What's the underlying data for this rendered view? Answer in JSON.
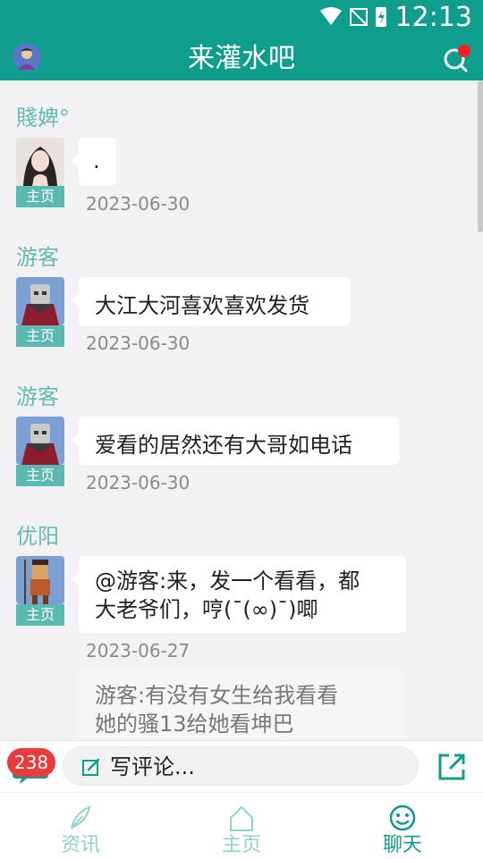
{
  "status": {
    "time": "12:13"
  },
  "appbar": {
    "title": "来灌水吧"
  },
  "messages": [
    {
      "user": "賤婢°",
      "home_label": "主页",
      "text": ".",
      "date": "2023-06-30"
    },
    {
      "user": "游客",
      "home_label": "主页",
      "text": "大江大河喜欢喜欢发货",
      "date": "2023-06-30"
    },
    {
      "user": "游客",
      "home_label": "主页",
      "text": "爱看的居然还有大哥如电话",
      "date": "2023-06-30"
    },
    {
      "user": "优阳",
      "home_label": "主页",
      "text_line1": "@游客:来，发一个看看，都",
      "text_line2": "大老爷们，哼(¯(∞)¯)唧",
      "date": "2023-06-27",
      "quote_line1": "游客:有没有女生给我看看",
      "quote_line2": "她的骚13给她看坤巴"
    }
  ],
  "comment_bar": {
    "badge": "238",
    "placeholder": "写评论..."
  },
  "tabs": [
    {
      "label": "资讯",
      "icon": "feather-icon",
      "active": false
    },
    {
      "label": "主页",
      "icon": "home-icon",
      "active": false
    },
    {
      "label": "聊天",
      "icon": "smiley-icon",
      "active": true
    }
  ],
  "colors": {
    "primary": "#0f9d8e",
    "username": "#67b9b1",
    "badge": "#ea3a3a",
    "tab_inactive": "#8fd3cb",
    "tab_active": "#11998d"
  }
}
